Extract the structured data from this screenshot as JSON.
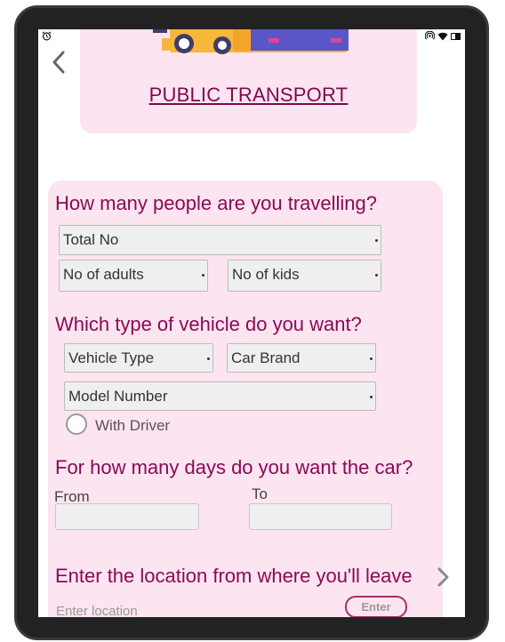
{
  "status": {
    "alarm_icon": "alarm-clock-icon",
    "right_icons": [
      "hotspot-icon",
      "wifi-icon",
      "battery-icon"
    ]
  },
  "header": {
    "title": "PUBLIC TRANSPORT",
    "back_icon": "chevron-left-icon"
  },
  "people": {
    "question": "How many people are you travelling?",
    "total": "Total No",
    "adults": "No of adults",
    "kids": "No of kids"
  },
  "vehicle": {
    "question": "Which type of vehicle do you want?",
    "type": "Vehicle Type",
    "brand": "Car Brand",
    "model": "Model Number",
    "driver_label": "With Driver"
  },
  "days": {
    "question": "For how many days do you want the car?",
    "from_label": "From",
    "to_label": "To"
  },
  "location": {
    "question": "Enter the location from where you'll leave",
    "placeholder": "Enter location",
    "enter_label": "Enter"
  },
  "colors": {
    "accent": "#8a0a55",
    "panel": "#fce4f0",
    "device": "#222222"
  }
}
